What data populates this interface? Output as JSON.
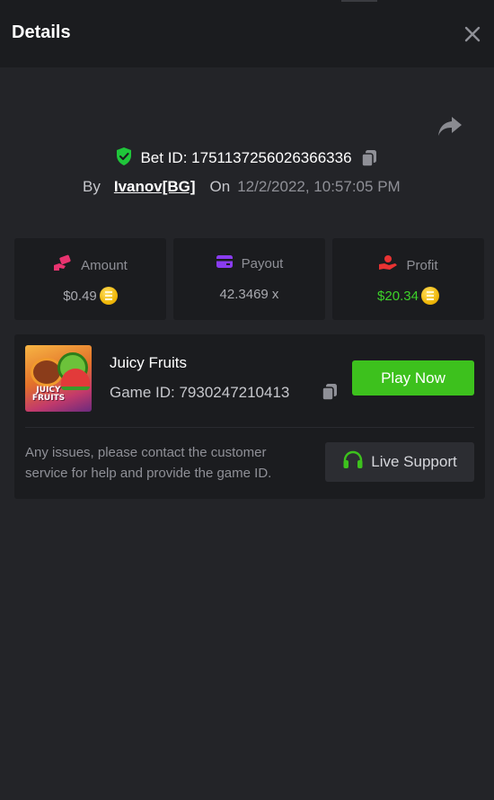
{
  "header": {
    "title": "Details"
  },
  "bet": {
    "id_label": "Bet ID: 1751137256026366336",
    "by_label": "By",
    "user": "Ivanov[BG]",
    "on_label": "On",
    "date": "12/2/2022, 10:57:05 PM"
  },
  "stats": [
    {
      "label": "Amount",
      "value": "$0.49",
      "icon": "hand-money-icon",
      "color": "#e8336f"
    },
    {
      "label": "Payout",
      "value": "42.3469 x",
      "icon": "card-icon",
      "color": "#8a3cf0"
    },
    {
      "label": "Profit",
      "value": "$20.34",
      "icon": "hand-coin-icon",
      "color": "#e83333"
    }
  ],
  "game": {
    "name": "Juicy Fruits",
    "id_label": "Game ID: 7930247210413",
    "thumb_text": "JUICY FRUITS",
    "play_label": "Play Now"
  },
  "support": {
    "message": "Any issues, please contact the customer service for help and provide the game ID.",
    "button_label": "Live Support"
  },
  "colors": {
    "accent_green": "#3dc11d",
    "profit_green": "#3dd22a",
    "verified_green": "#1fc53a"
  }
}
